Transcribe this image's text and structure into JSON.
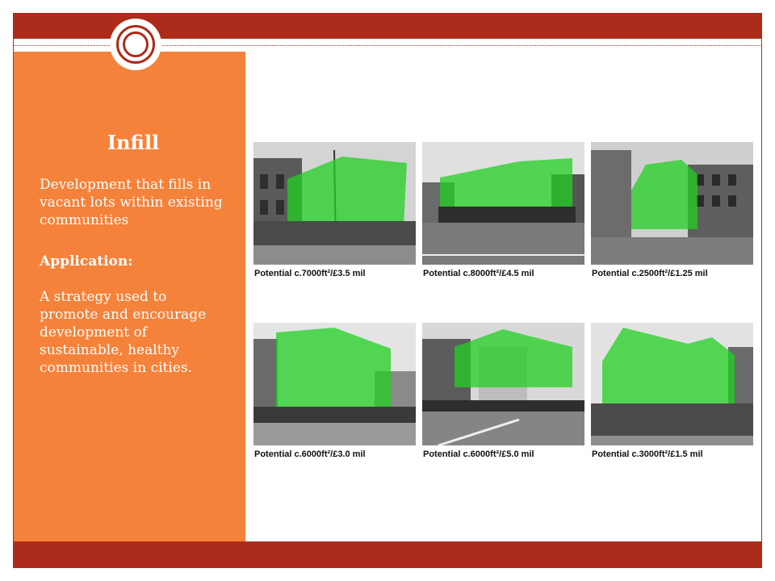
{
  "slide": {
    "title": "Infill",
    "description": "Development that fills in vacant lots within existing communities",
    "application_label": "Application:",
    "application_text": "A strategy used to promote and encourage development of sustainable, healthy communities in cities."
  },
  "photos": [
    {
      "caption": "Potential c.7000ft²/£3.5 mil"
    },
    {
      "caption": "Potential c.8000ft²/£4.5 mil"
    },
    {
      "caption": "Potential c.2500ft²/£1.25 mil"
    },
    {
      "caption": "Potential c.6000ft²/£3.0 mil"
    },
    {
      "caption": "Potential c.6000ft²/£5.0 mil"
    },
    {
      "caption": "Potential c.3000ft²/£1.5 mil"
    }
  ],
  "colors": {
    "accent_red": "#ad2b1a",
    "panel_orange": "#f5823a",
    "overlay_green": "#22d022"
  }
}
